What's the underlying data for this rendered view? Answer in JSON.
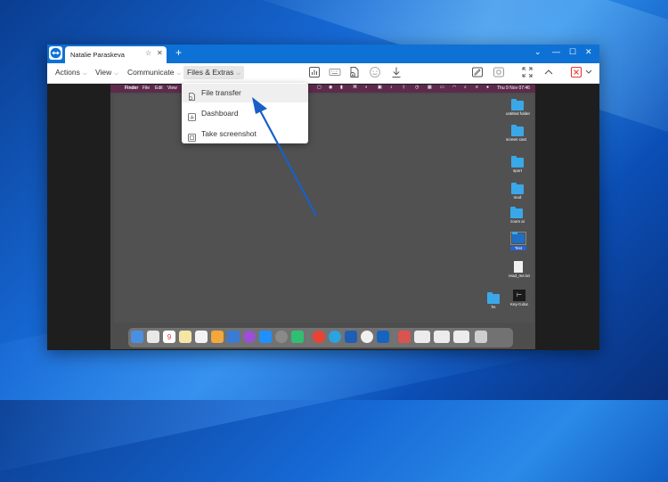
{
  "titlebar": {
    "tab_title": "Natalie Paraskeva",
    "tab_star": "☆",
    "tab_close": "✕",
    "new_tab": "+",
    "controls": [
      "⌄",
      "—",
      "☐",
      "✕"
    ]
  },
  "toolbar": {
    "menus": [
      {
        "label": "Actions"
      },
      {
        "label": "View"
      },
      {
        "label": "Communicate"
      },
      {
        "label": "Files & Extras",
        "active": true
      }
    ],
    "chevron": "⌵"
  },
  "dropdown": {
    "items": [
      {
        "label": "File transfer",
        "icon": "file-transfer-icon",
        "hover": true
      },
      {
        "label": "Dashboard",
        "icon": "dashboard-icon"
      },
      {
        "label": "Take screenshot",
        "icon": "screenshot-icon"
      }
    ]
  },
  "remote": {
    "menubar": {
      "apple": "",
      "items": [
        "Finder",
        "File",
        "Edit",
        "View"
      ],
      "clock": "Thu 9 Nov  07:46"
    },
    "desktop_icons": [
      {
        "label": "untitled folder",
        "type": "folder"
      },
      {
        "label": "screen cast",
        "type": "folder"
      },
      {
        "label": "sport",
        "type": "folder"
      },
      {
        "label": "mod",
        "type": "folder"
      },
      {
        "label": "zoom ai",
        "type": "folder"
      },
      {
        "label": "Test",
        "type": "folder-selected"
      },
      {
        "label": "read_me.txt",
        "type": "file"
      },
      {
        "label": "Key-0.doc",
        "type": "file-dark"
      },
      {
        "label": "hs",
        "type": "folder"
      }
    ],
    "dock_calendar_day": "9"
  },
  "colors": {
    "titlebar": "#0e71d6",
    "accent": "#1565c0",
    "arrow": "#1a5fc7",
    "mac_menubar": "#5d2a4c",
    "folder": "#3aa8e8",
    "close_red": "#e53935"
  }
}
